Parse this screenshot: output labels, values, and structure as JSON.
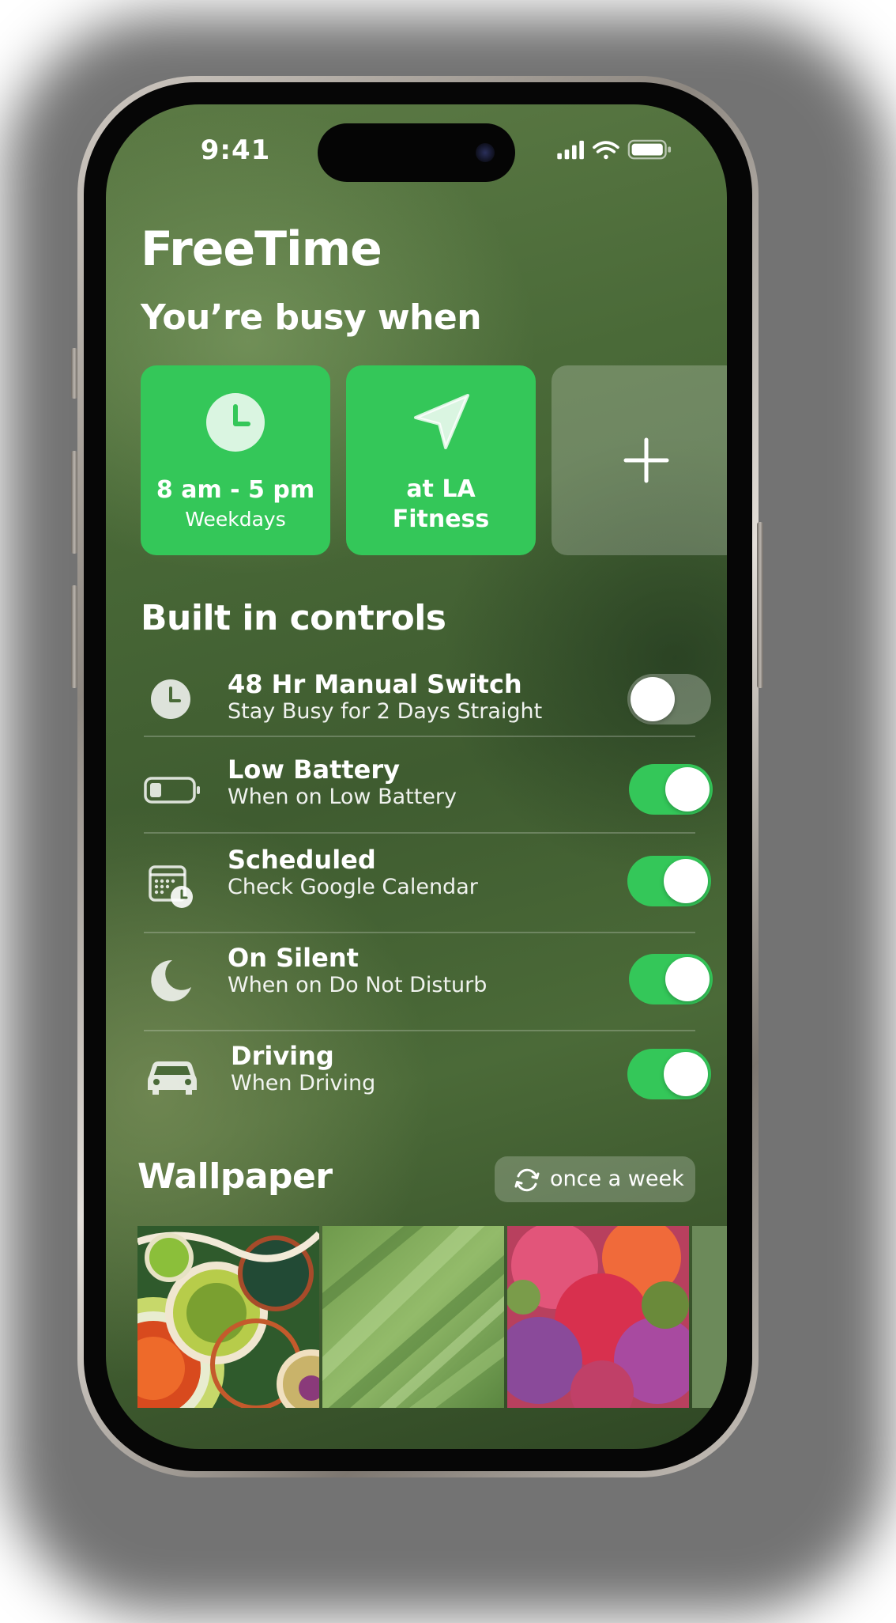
{
  "status_bar": {
    "time": "9:41"
  },
  "app": {
    "title": "FreeTime"
  },
  "busy": {
    "heading": "You’re busy when",
    "cards": [
      {
        "icon": "clock-icon",
        "line1": "8 am - 5 pm",
        "line2": "Weekdays"
      },
      {
        "icon": "location-arrow-icon",
        "line1": "at LA Fitness"
      }
    ],
    "add_icon": "plus-icon"
  },
  "controls": {
    "heading": "Built in controls",
    "items": [
      {
        "icon": "clock-icon",
        "title": "48 Hr Manual Switch",
        "subtitle": "Stay Busy for 2 Days Straight",
        "enabled": false
      },
      {
        "icon": "battery-low-icon",
        "title": "Low Battery",
        "subtitle": "When on Low Battery",
        "enabled": true
      },
      {
        "icon": "calendar-clock-icon",
        "title": "Scheduled",
        "subtitle": "Check Google Calendar",
        "enabled": true
      },
      {
        "icon": "moon-icon",
        "title": "On Silent",
        "subtitle": "When on Do Not Disturb",
        "enabled": true
      },
      {
        "icon": "car-icon",
        "title": "Driving",
        "subtitle": "When Driving",
        "enabled": true
      }
    ]
  },
  "wallpaper": {
    "heading": "Wallpaper",
    "frequency": {
      "icon": "refresh-icon",
      "label": "once a week"
    },
    "thumbnails": [
      "abstract-agate-swirl",
      "green-grass-blur",
      "pink-flower-blur"
    ]
  },
  "colors": {
    "accent_green": "#34c759",
    "background_green": "#4a6a38"
  }
}
